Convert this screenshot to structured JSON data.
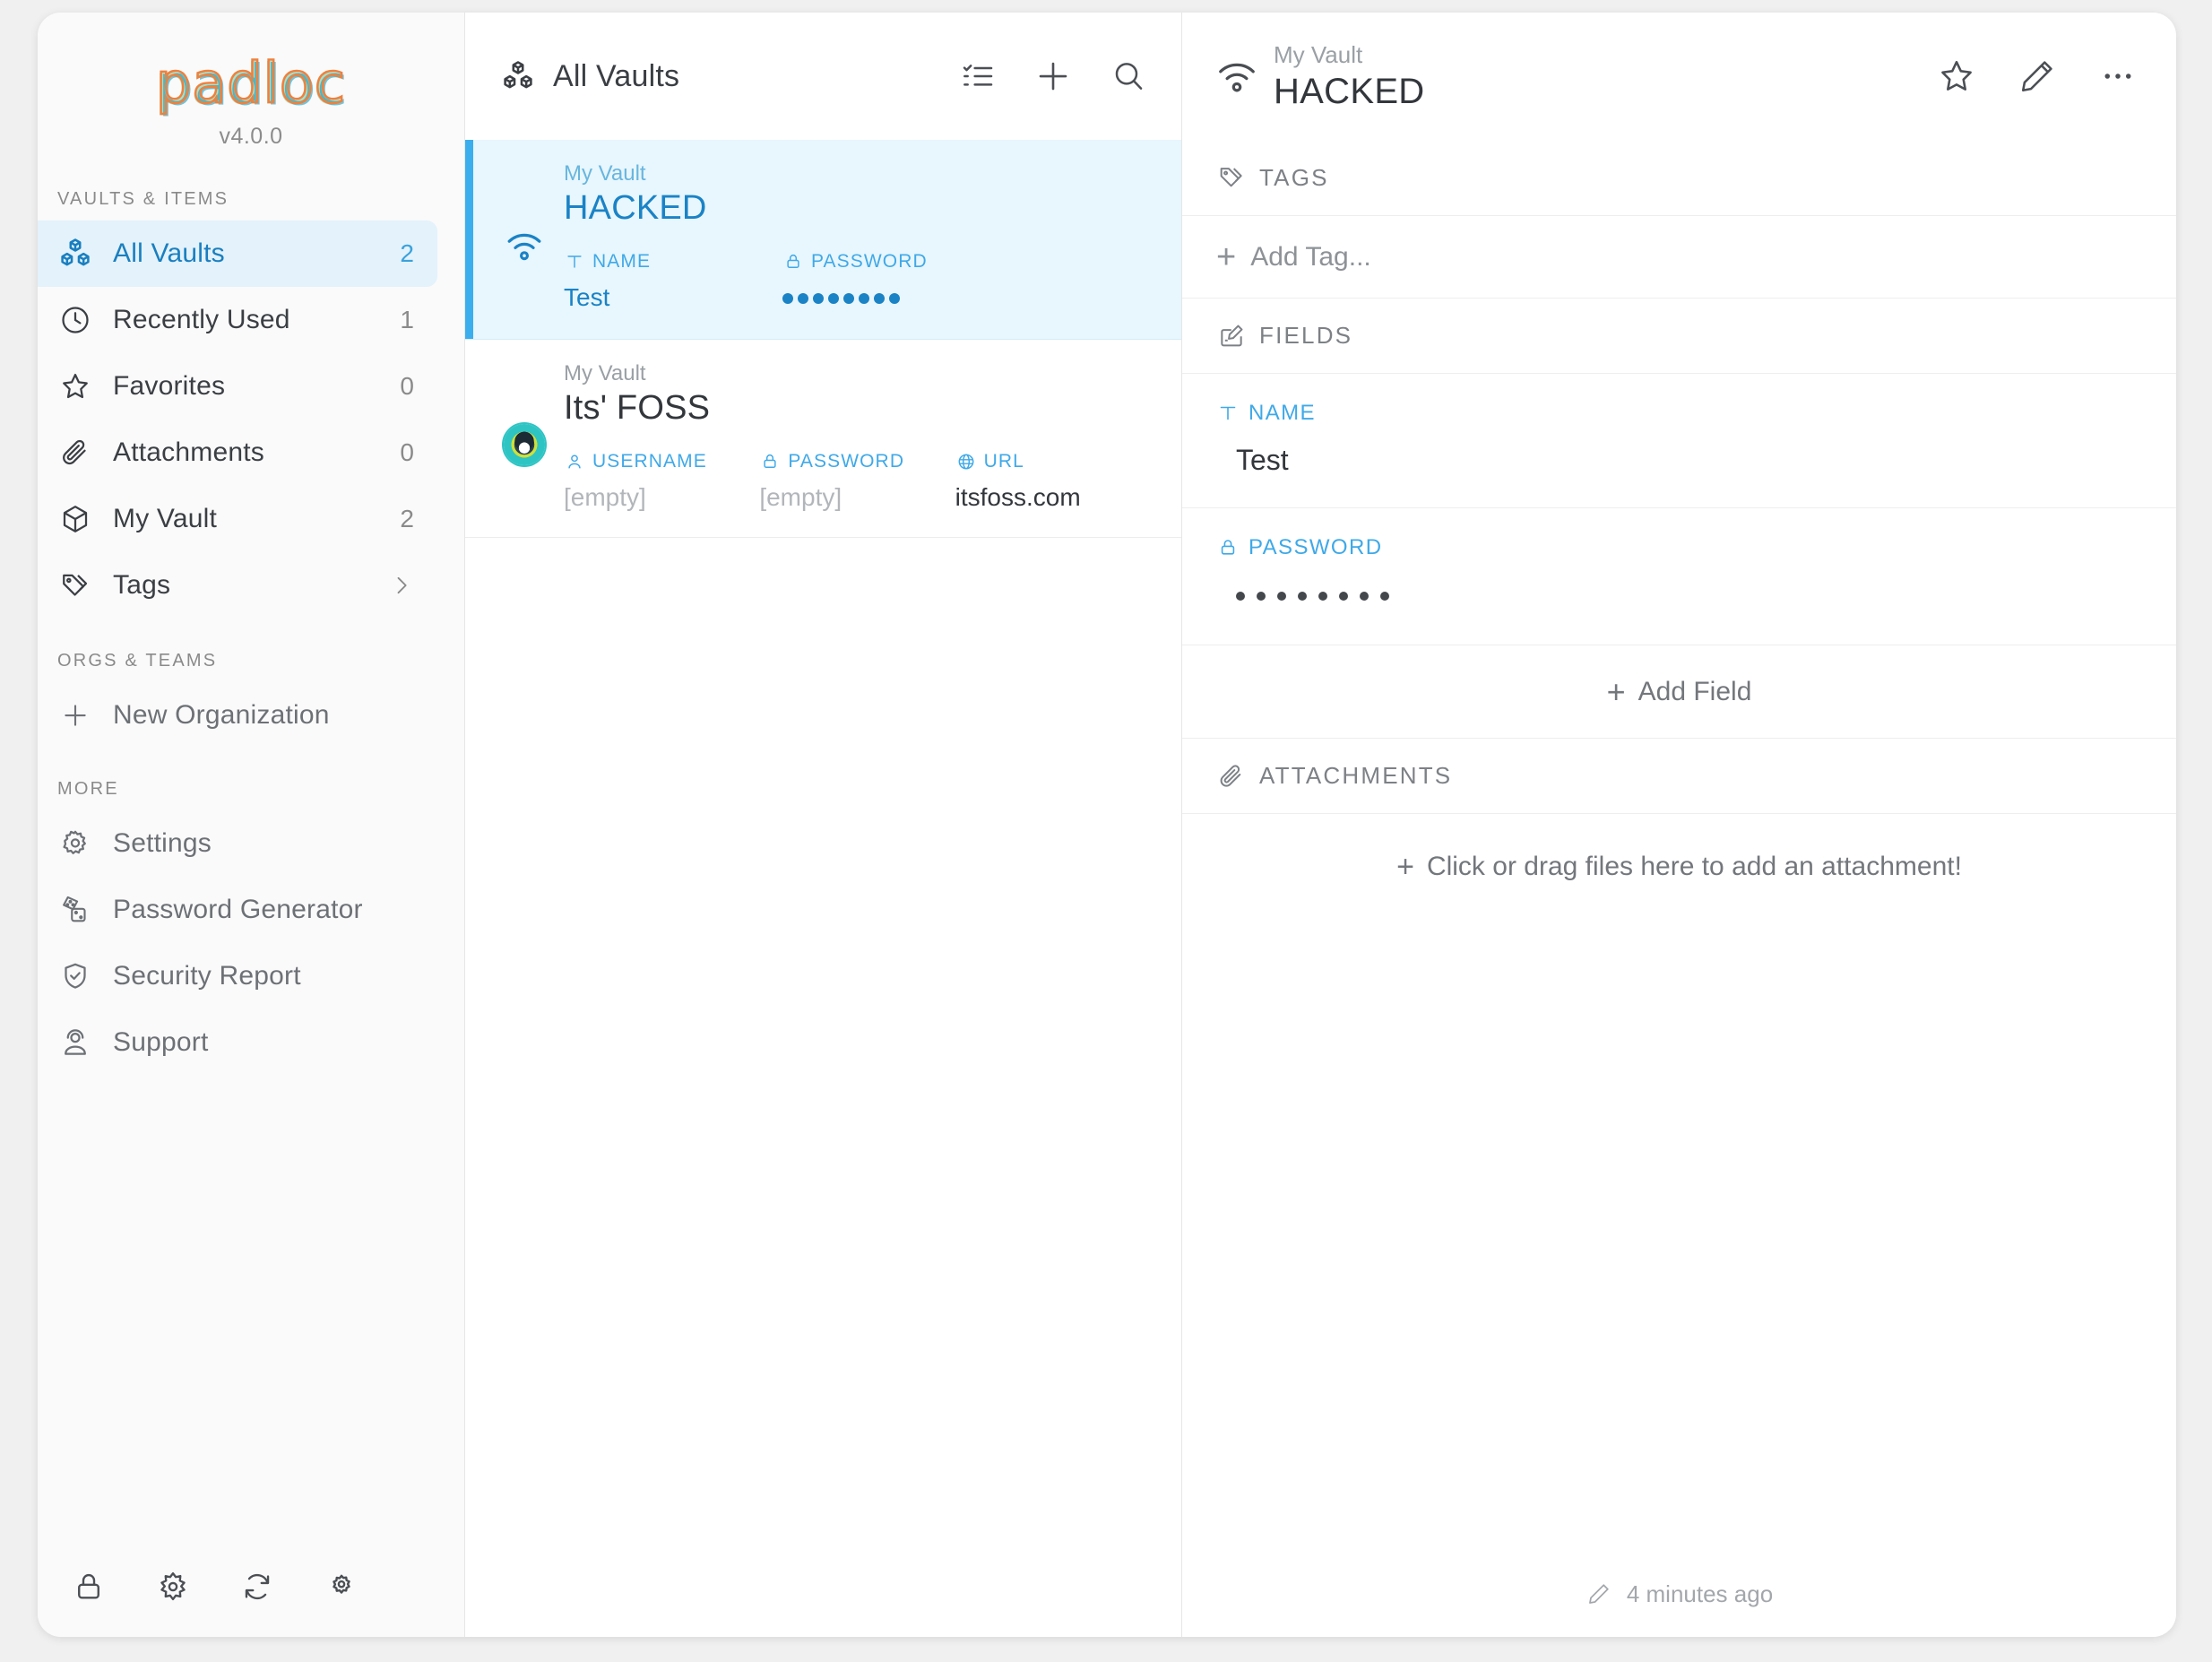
{
  "app": {
    "logo_text": "padloc",
    "version": "v4.0.0"
  },
  "sidebar": {
    "sections": {
      "vaults_items": "VAULTS & ITEMS",
      "orgs_teams": "ORGS & TEAMS",
      "more": "MORE"
    },
    "vault_items": [
      {
        "label": "All Vaults",
        "count": "2",
        "icon": "cubes-icon",
        "selected": true
      },
      {
        "label": "Recently Used",
        "count": "1",
        "icon": "clock-icon",
        "selected": false
      },
      {
        "label": "Favorites",
        "count": "0",
        "icon": "star-icon",
        "selected": false
      },
      {
        "label": "Attachments",
        "count": "0",
        "icon": "paperclip-icon",
        "selected": false
      },
      {
        "label": "My Vault",
        "count": "2",
        "icon": "cube-icon",
        "selected": false
      },
      {
        "label": "Tags",
        "count": "",
        "icon": "tag-icon",
        "selected": false,
        "chevron": true
      }
    ],
    "org_items": [
      {
        "label": "New Organization",
        "icon": "plus-icon"
      }
    ],
    "more_items": [
      {
        "label": "Settings",
        "icon": "gear-icon"
      },
      {
        "label": "Password Generator",
        "icon": "dice-icon"
      },
      {
        "label": "Security Report",
        "icon": "shield-check-icon"
      },
      {
        "label": "Support",
        "icon": "support-person-icon"
      }
    ],
    "footer_buttons": [
      {
        "icon": "lock-icon"
      },
      {
        "icon": "sun-gear-icon"
      },
      {
        "icon": "refresh-icon"
      },
      {
        "icon": "gear-icon"
      }
    ]
  },
  "list": {
    "header": {
      "title": "All Vaults",
      "icon": "cubes-icon",
      "buttons": [
        {
          "icon": "checklist-icon"
        },
        {
          "icon": "plus-icon"
        },
        {
          "icon": "search-icon"
        }
      ]
    },
    "items": [
      {
        "vault": "My Vault",
        "title": "HACKED",
        "icon": "wifi-icon",
        "selected": true,
        "fields": [
          {
            "label": "NAME",
            "icon": "text-icon",
            "value": "Test",
            "type": "text"
          },
          {
            "label": "PASSWORD",
            "icon": "lock-icon",
            "value": "",
            "type": "masked",
            "dots": 8
          }
        ]
      },
      {
        "vault": "My Vault",
        "title": "Its' FOSS",
        "icon": "itsfoss-favicon",
        "selected": false,
        "fields": [
          {
            "label": "USERNAME",
            "icon": "person-icon",
            "value": "[empty]",
            "type": "empty"
          },
          {
            "label": "PASSWORD",
            "icon": "lock-icon",
            "value": "[empty]",
            "type": "empty"
          },
          {
            "label": "URL",
            "icon": "globe-icon",
            "value": "itsfoss.com",
            "type": "text"
          }
        ]
      }
    ]
  },
  "detail": {
    "vault": "My Vault",
    "title": "HACKED",
    "icon": "wifi-icon",
    "header_buttons": [
      {
        "icon": "star-icon"
      },
      {
        "icon": "pencil-icon"
      },
      {
        "icon": "ellipsis-icon"
      }
    ],
    "tags": {
      "heading": "TAGS",
      "heading_icon": "tag-icon",
      "add_label": "Add Tag..."
    },
    "fields": {
      "heading": "FIELDS",
      "heading_icon": "form-edit-icon",
      "rows": [
        {
          "label": "NAME",
          "icon": "text-icon",
          "value": "Test",
          "type": "text"
        },
        {
          "label": "PASSWORD",
          "icon": "lock-icon",
          "value": "",
          "type": "masked",
          "dots": 8
        }
      ],
      "add_label": "Add Field"
    },
    "attachments": {
      "heading": "ATTACHMENTS",
      "heading_icon": "paperclip-icon",
      "dropzone_label": "Click or drag files here to add an attachment!"
    },
    "footer": {
      "icon": "pencil-icon",
      "timestamp": "4 minutes ago"
    }
  },
  "colors": {
    "accent_blue": "#3baeee",
    "deep_blue": "#1a7fbf",
    "label_blue": "#3fa9e8",
    "selected_bg": "#e8f6fd",
    "sidebar_selected_bg": "#e3f2fb",
    "text_dark": "#33373c",
    "text_muted": "#8a8a8a"
  }
}
